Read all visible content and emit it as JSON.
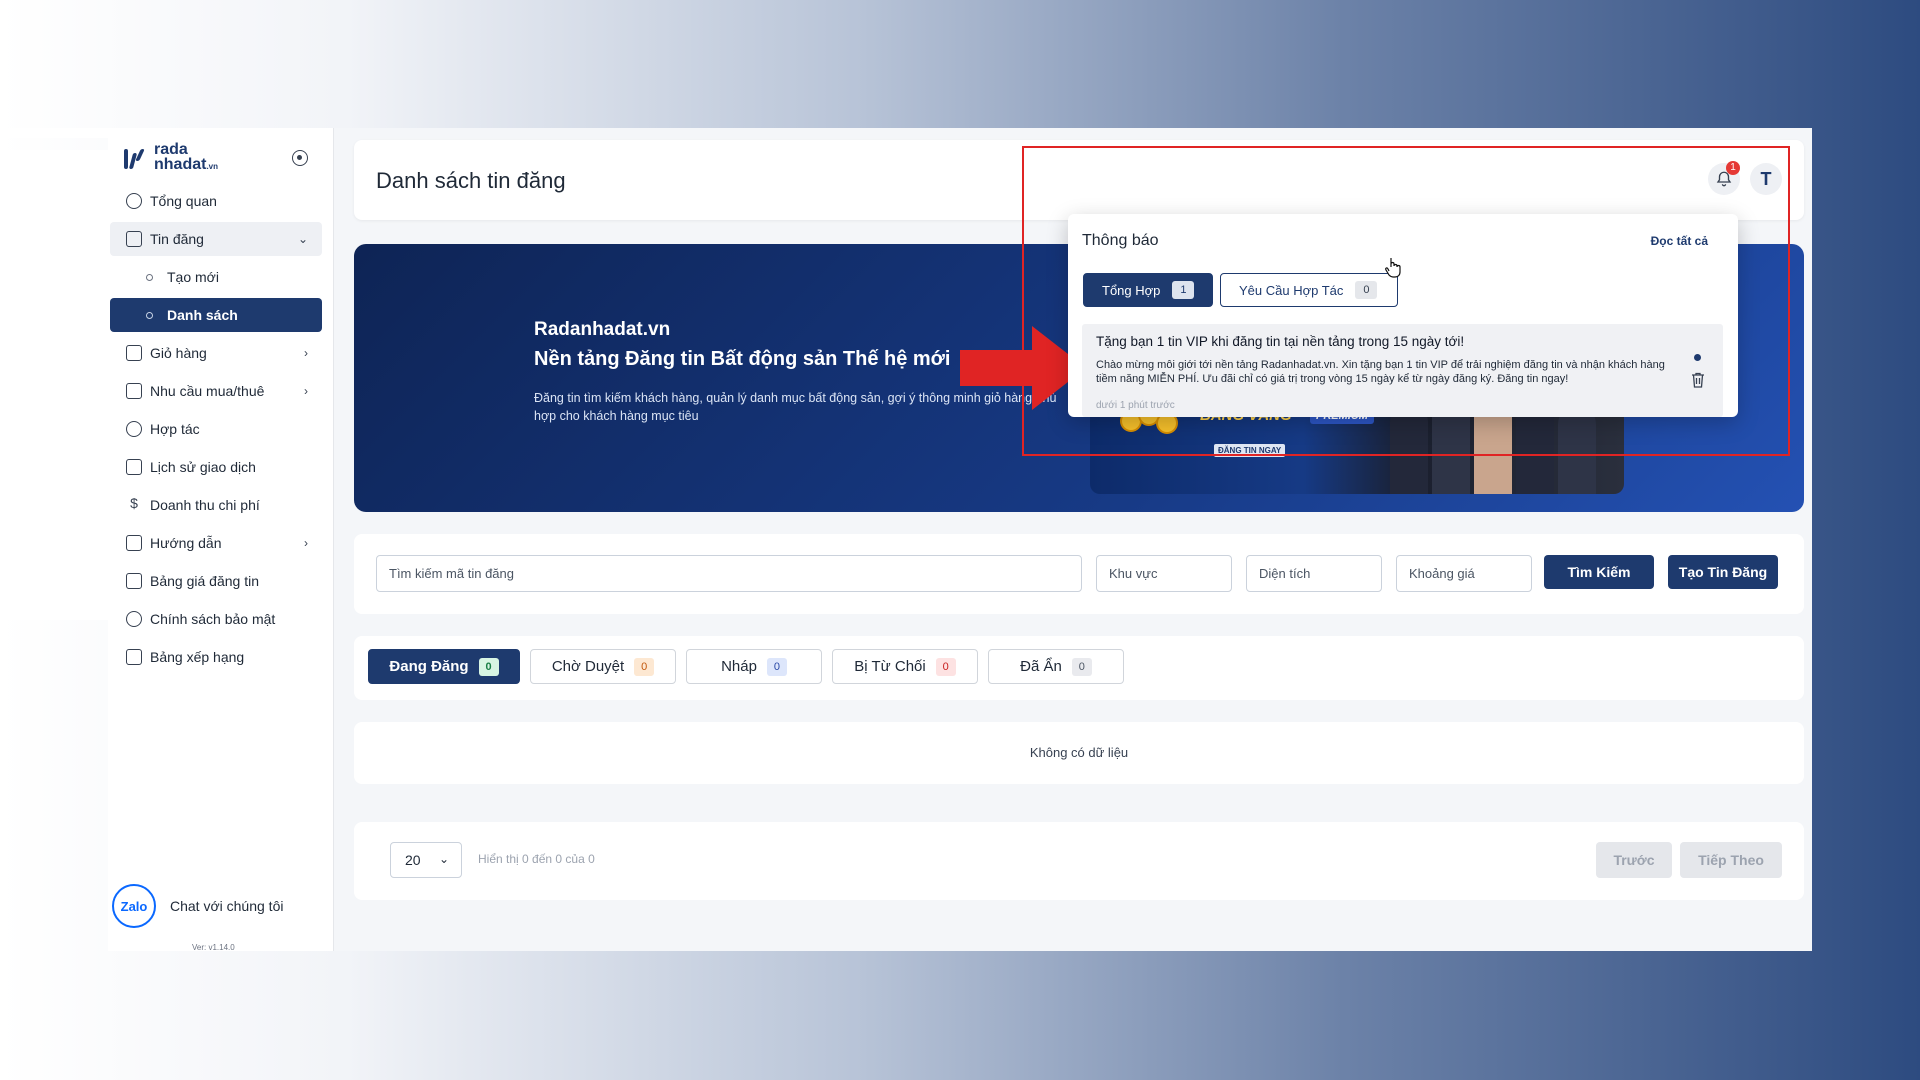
{
  "app": {
    "logo_line1": "rada",
    "logo_line2": "nhadat",
    "logo_suffix": ".vn",
    "version": "Ver: v1.14.0"
  },
  "sidebar": {
    "items": [
      {
        "label": "Tổng quan",
        "icon": "home-icon"
      },
      {
        "label": "Tin đăng",
        "icon": "document-icon",
        "expanded": true
      },
      {
        "label": "Tạo mới",
        "sub": true
      },
      {
        "label": "Danh sách",
        "sub": true,
        "active": true
      },
      {
        "label": "Giỏ hàng",
        "icon": "basket-icon",
        "has_children": true
      },
      {
        "label": "Nhu cầu mua/thuê",
        "icon": "user-needs-icon",
        "has_children": true
      },
      {
        "label": "Hợp tác",
        "icon": "handshake-icon"
      },
      {
        "label": "Lịch sử giao dịch",
        "icon": "history-icon"
      },
      {
        "label": "Doanh thu chi phí",
        "icon": "dollar-icon"
      },
      {
        "label": "Hướng dẫn",
        "icon": "book-icon",
        "has_children": true
      },
      {
        "label": "Bảng giá đăng tin",
        "icon": "cart-icon"
      },
      {
        "label": "Chính sách bảo mật",
        "icon": "shield-icon"
      },
      {
        "label": "Bảng xếp hạng",
        "icon": "ranking-icon"
      }
    ],
    "chat_label": "Chat với chúng tôi",
    "zalo_label": "Zalo"
  },
  "header": {
    "title": "Danh sách tin đăng",
    "notification_count": "1",
    "avatar_letter": "T"
  },
  "banner": {
    "site": "Radanhadat.vn",
    "tagline": "Nền tảng Đăng tin Bất động sản Thế hệ mới",
    "description": "Đăng tin tìm kiếm khách hàng, quản lý danh mục bất động sản, gợi ý thông minh giỏ hàng phù hợp cho khách hàng mục tiêu",
    "promo_gold": "BẢNG VÀNG",
    "promo_premium": "PREMIUM",
    "promo_cta": "ĐĂNG TIN NGAY"
  },
  "notifications": {
    "title": "Thông báo",
    "read_all": "Đọc tất cả",
    "tabs": [
      {
        "label": "Tổng Hợp",
        "count": "1",
        "active": true
      },
      {
        "label": "Yêu Cầu Hợp Tác",
        "count": "0"
      }
    ],
    "item": {
      "title": "Tặng bạn 1 tin VIP khi đăng tin tại nền tảng trong 15 ngày tới!",
      "body": "Chào mừng môi giới tới nền tảng Radanhadat.vn. Xin tặng bạn 1 tin VIP để trải nghiệm đăng tin và nhận khách hàng tiềm năng MIỄN PHÍ. Ưu đãi chỉ có giá trị trong vòng 15 ngày kể từ ngày đăng ký. Đăng tin ngay!",
      "time": "dưới 1 phút trước"
    }
  },
  "search": {
    "code_placeholder": "Tìm kiếm mã tin đăng",
    "area_placeholder": "Khu vực",
    "size_placeholder": "Diện tích",
    "price_placeholder": "Khoảng giá",
    "search_button": "Tìm Kiếm",
    "create_button": "Tạo Tin Đăng"
  },
  "status_tabs": [
    {
      "label": "Đang Đăng",
      "count": "0",
      "color": "#1a7f46",
      "active": true
    },
    {
      "label": "Chờ Duyệt",
      "count": "0",
      "color": "#c2570c"
    },
    {
      "label": "Nháp",
      "count": "0",
      "color": "#2948a6"
    },
    {
      "label": "Bị Từ Chối",
      "count": "0",
      "color": "#c81e1e"
    },
    {
      "label": "Đã Ẩn",
      "count": "0",
      "color": "#4b5563"
    }
  ],
  "empty_text": "Không có dữ liệu",
  "pagination": {
    "page_size": "20",
    "showing": "Hiển thị 0 đến 0 của 0",
    "prev": "Trước",
    "next": "Tiếp Theo"
  },
  "colors": {
    "primary": "#1e3a6e",
    "highlight_red": "#e02424"
  }
}
